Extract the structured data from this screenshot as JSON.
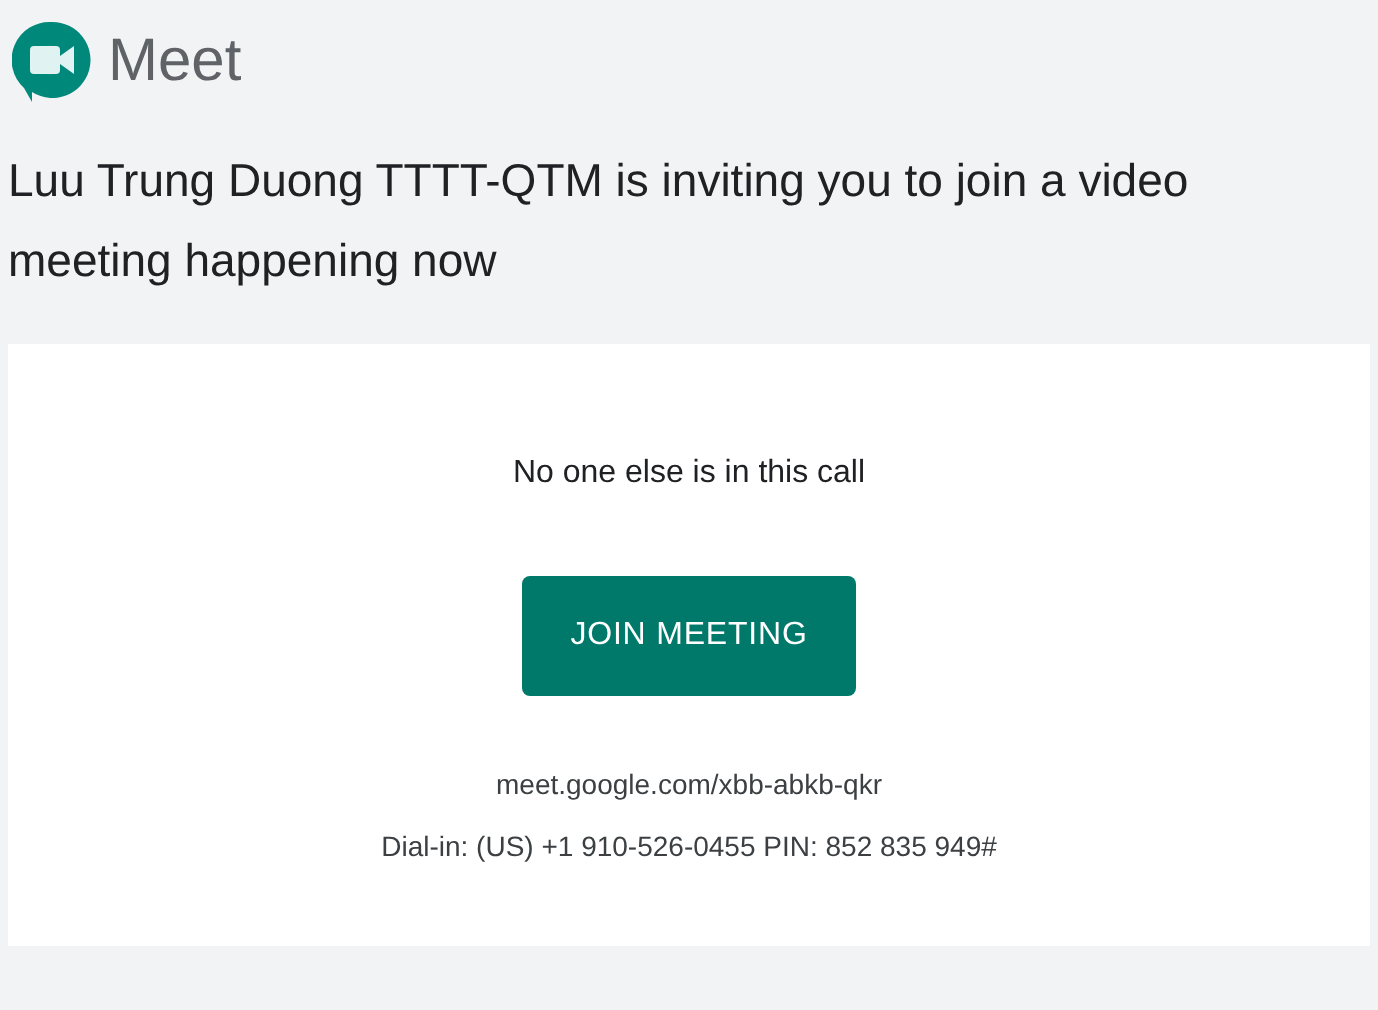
{
  "brand": {
    "name": "Meet"
  },
  "invitation": "Luu Trung Duong TTTT-QTM is inviting you to join a video meeting happening now",
  "card": {
    "status": "No one else is in this call",
    "join_button": "JOIN MEETING",
    "link": "meet.google.com/xbb-abkb-qkr",
    "dial_in": "Dial-in: (US) +1 910-526-0455 PIN: 852 835 949#"
  }
}
